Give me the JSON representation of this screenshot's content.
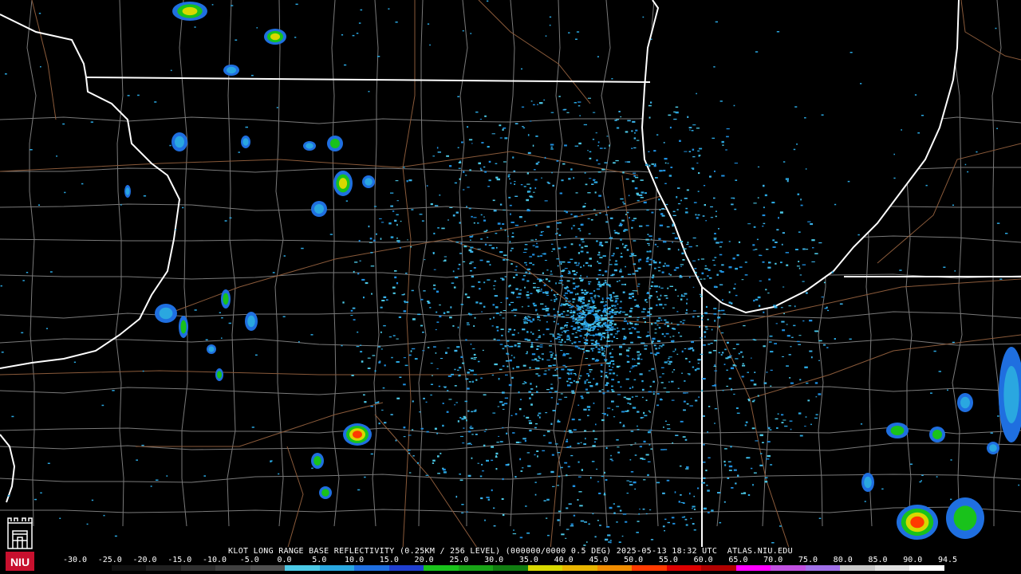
{
  "caption": "KLOT LONG RANGE BASE REFLECTIVITY (0.25KM / 256 LEVEL) (000000/0000 0.5 DEG) 2025-05-13 18:32 UTC  ATLAS.NIU.EDU",
  "scale": {
    "labels": [
      "-30.0",
      "-25.0",
      "-20.0",
      "-15.0",
      "-10.0",
      "-5.0",
      "0.0",
      "5.0",
      "10.0",
      "15.0",
      "20.0",
      "25.0",
      "30.0",
      "35.0",
      "40.0",
      "45.0",
      "50.0",
      "55.0",
      "60.0",
      "65.0",
      "70.0",
      "75.0",
      "80.0",
      "85.0",
      "90.0",
      "94.5"
    ],
    "colors": [
      "#000000",
      "#101010",
      "#202020",
      "#303030",
      "#404040",
      "#505050",
      "#4cc9e6",
      "#2aa7e0",
      "#1f6fe0",
      "#1f3fd0",
      "#19c21b",
      "#18a316",
      "#117d11",
      "#d8d800",
      "#e8b400",
      "#f08c00",
      "#ff3a00",
      "#dd0000",
      "#b00000",
      "#ff00ff",
      "#c050e0",
      "#a070e8",
      "#c8c8c8",
      "#e0e0e0",
      "#ffffff"
    ]
  },
  "map": {
    "radar_site": "KLOT",
    "state_border_color": "#ffffff",
    "county_line_color": "#7a7a7a",
    "highway_color": "#8a5a3a"
  },
  "logo": {
    "text": "NIU",
    "color": "#c8102e"
  }
}
